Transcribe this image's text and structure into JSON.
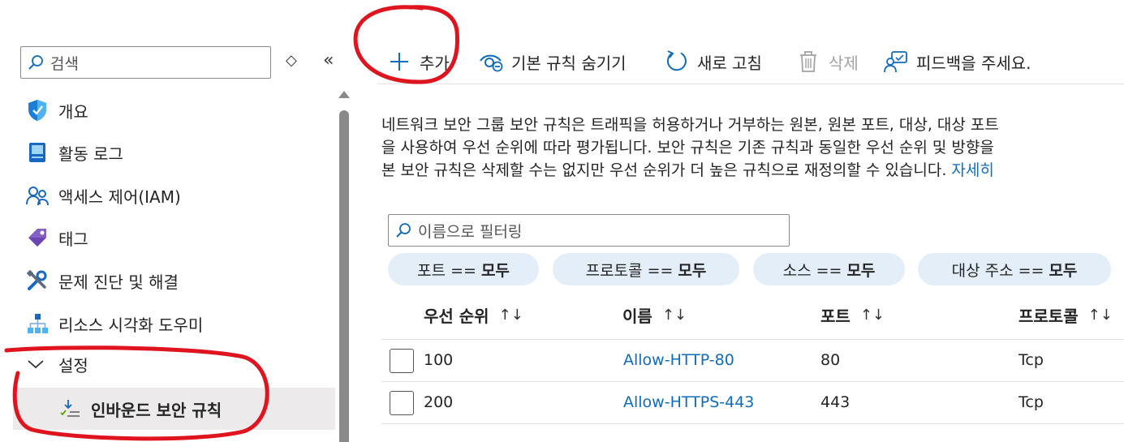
{
  "sidebar": {
    "search_placeholder": "검색",
    "items": [
      {
        "label": "개요",
        "icon": "shield-icon"
      },
      {
        "label": "활동 로그",
        "icon": "log-book-icon"
      },
      {
        "label": "액세스 제어(IAM)",
        "icon": "people-icon"
      },
      {
        "label": "태그",
        "icon": "tag-icon"
      },
      {
        "label": "문제 진단 및 해결",
        "icon": "wrench-icon"
      },
      {
        "label": "리소스 시각화 도우미",
        "icon": "network-tree-icon"
      },
      {
        "label": "설정",
        "icon": "chevron-down-icon"
      },
      {
        "label": "인바운드 보안 규칙",
        "icon": "download-list-icon",
        "selected": true
      }
    ]
  },
  "toolbar": {
    "add": "추가",
    "hide_default": "기본 규칙 숨기기",
    "refresh": "새로 고침",
    "delete": "삭제",
    "feedback": "피드백을 주세요."
  },
  "description": {
    "line1": "네트워크 보안 그룹 보안 규칙은 트래픽을 허용하거나 거부하는 원본, 원본 포트, 대상, 대상 포트",
    "line2": "을 사용하여 우선 순위에 따라 평가됩니다. 보안 규칙은 기존 규칙과 동일한 우선 순위 및 방향을",
    "line3": "본 보안 규칙은 삭제할 수는 없지만 우선 순위가 더 높은 규칙으로 재정의할 수 있습니다.",
    "link": "자세히"
  },
  "filter": {
    "placeholder": "이름으로 필터링",
    "pills": [
      {
        "key": "포트 ==",
        "value": "모두"
      },
      {
        "key": "프로토콜 ==",
        "value": "모두"
      },
      {
        "key": "소스 ==",
        "value": "모두"
      },
      {
        "key": "대상 주소 ==",
        "value": "모두"
      }
    ]
  },
  "table": {
    "columns": [
      "우선 순위",
      "이름",
      "포트",
      "프로토콜"
    ],
    "sort_glyph": "↑↓",
    "rows": [
      {
        "priority": "100",
        "name": "Allow-HTTP-80",
        "port": "80",
        "protocol": "Tcp"
      },
      {
        "priority": "200",
        "name": "Allow-HTTPS-443",
        "port": "443",
        "protocol": "Tcp"
      }
    ]
  },
  "colors": {
    "link": "#0f6cbd",
    "accent": "#0078d4",
    "pill_bg": "#e3eef9",
    "annotation": "#e0141e"
  }
}
